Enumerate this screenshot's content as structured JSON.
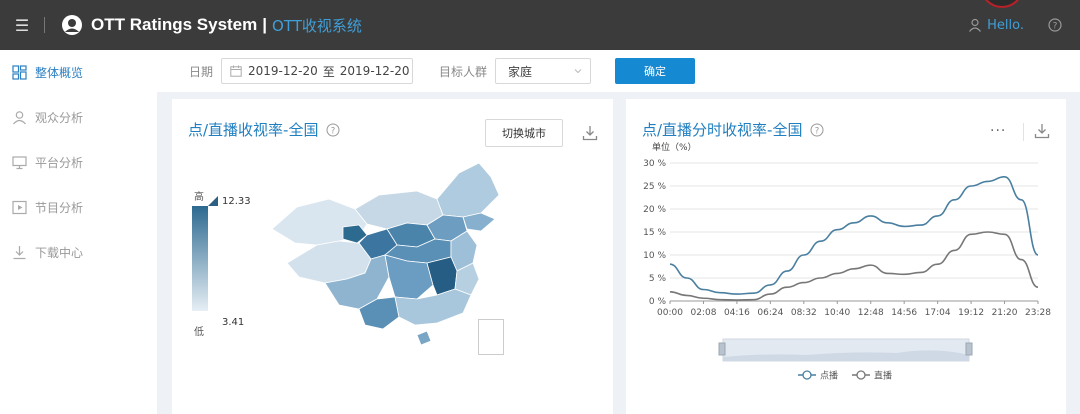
{
  "topbar": {
    "menu_icon": "hamburger-icon",
    "brand": "OTT Ratings System",
    "brand_sep": "|",
    "brand_cn": "OTT收视系统",
    "user_greeting": "Hello.",
    "help_icon": "help-circle-icon"
  },
  "sidebar": {
    "items": [
      {
        "label": "整体概览",
        "icon": "dashboard-icon",
        "active": true
      },
      {
        "label": "观众分析",
        "icon": "user-icon",
        "active": false
      },
      {
        "label": "平台分析",
        "icon": "monitor-icon",
        "active": false
      },
      {
        "label": "节目分析",
        "icon": "play-icon",
        "active": false
      },
      {
        "label": "下载中心",
        "icon": "download-icon",
        "active": false
      }
    ]
  },
  "filters": {
    "date_label": "日期",
    "date_start": "2019-12-20",
    "date_to": "至",
    "date_end": "2019-12-20",
    "audience_label": "目标人群",
    "audience_value": "家庭",
    "confirm_label": "确定"
  },
  "map_panel": {
    "title": "点/直播收视率-全国",
    "switch_city": "切换城市",
    "legend_high_label": "高",
    "legend_low_label": "低",
    "legend_high_value": "12.33",
    "legend_low_value": "3.41"
  },
  "line_panel": {
    "title": "点/直播分时收视率-全国",
    "more": "···"
  },
  "chart_data": {
    "type": "line",
    "title": "点/直播分时收视率-全国",
    "ylabel": "单位（%）",
    "xlabel": "",
    "ylim": [
      0,
      30
    ],
    "yticks": [
      "0 %",
      "5 %",
      "10 %",
      "15 %",
      "20 %",
      "25 %",
      "30 %"
    ],
    "xticks": [
      "00:00",
      "02:08",
      "04:16",
      "06:24",
      "08:32",
      "10:40",
      "12:48",
      "14:56",
      "17:04",
      "19:12",
      "21:20",
      "23:28"
    ],
    "grid": true,
    "legend_position": "bottom",
    "x": [
      "00:00",
      "01:04",
      "02:08",
      "03:12",
      "04:16",
      "05:20",
      "06:24",
      "07:28",
      "08:32",
      "09:36",
      "10:40",
      "11:44",
      "12:48",
      "13:52",
      "14:56",
      "16:00",
      "17:04",
      "18:08",
      "19:12",
      "20:16",
      "21:20",
      "22:24",
      "23:28"
    ],
    "series": [
      {
        "name": "点播",
        "color": "#4a7fa0",
        "values": [
          8,
          5,
          2.5,
          1.8,
          1.5,
          1.7,
          3.5,
          6.5,
          10,
          13,
          15.5,
          17,
          18.5,
          17,
          16.2,
          16.5,
          18.5,
          22,
          25,
          26,
          27,
          22,
          10
        ]
      },
      {
        "name": "直播",
        "color": "#777777",
        "values": [
          2,
          1.2,
          0.6,
          0.3,
          0.2,
          0.3,
          1.5,
          3,
          4,
          5,
          6,
          7,
          7.8,
          6,
          5.8,
          6.2,
          8,
          11,
          14.5,
          15,
          14.5,
          9,
          3
        ]
      }
    ]
  }
}
